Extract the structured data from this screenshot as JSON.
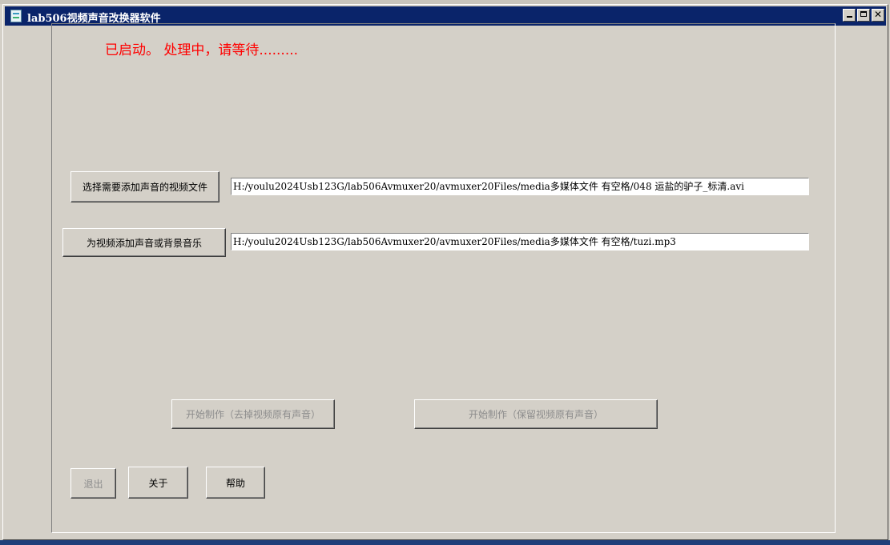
{
  "window": {
    "title": "lab506视频声音改换器软件"
  },
  "status_text": "已启动。 处理中，请等待.........",
  "video": {
    "select_button_label": "选择需要添加声音的视频文件",
    "path_value": "H:/youlu2024Usb123G/lab506Avmuxer20/avmuxer20Files/media多媒体文件  有空格/048 运盐的驴子_标清.avi"
  },
  "audio": {
    "select_button_label": "为视频添加声音或背景音乐",
    "path_value": "H:/youlu2024Usb123G/lab506Avmuxer20/avmuxer20Files/media多媒体文件  有空格/tuzi.mp3"
  },
  "actions": {
    "start_remove_label": "开始制作（去掉视频原有声音）",
    "start_keep_label": "开始制作（保留视频原有声音）"
  },
  "footer": {
    "exit_label": "退出",
    "about_label": "关于",
    "help_label": "帮助"
  },
  "icons": {
    "app": "app-icon",
    "minimize": "minimize-icon",
    "maximize": "maximize-icon",
    "close": "close-icon"
  },
  "colors": {
    "titlebar": "#0a246a",
    "status": "#ff0000",
    "face": "#d4d0c8"
  }
}
